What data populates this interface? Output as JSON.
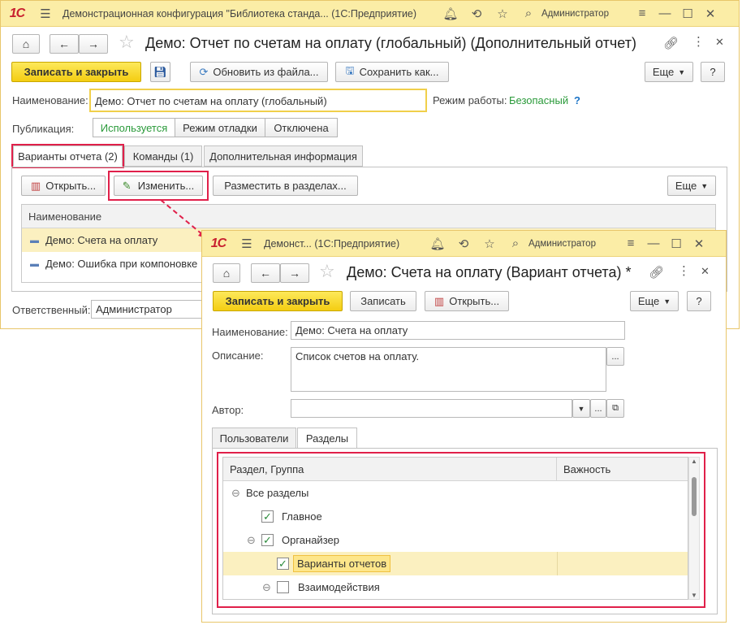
{
  "back_window": {
    "titlebar": {
      "logo": "1С",
      "title": "Демонстрационная конфигурация \"Библиотека станда...  (1С:Предприятие)",
      "user": "Администратор"
    },
    "header": "Демо: Отчет по счетам на оплату (глобальный) (Дополнительный отчет)",
    "toolbar": {
      "save_close": "Записать и закрыть",
      "update_from_file": "Обновить из файла...",
      "save_as": "Сохранить как...",
      "more": "Еще",
      "help": "?"
    },
    "name_label": "Наименование:",
    "name_value": "Демо: Отчет по счетам на оплату (глобальный)",
    "mode_label": "Режим работы:",
    "mode_value": "Безопасный",
    "mode_help": "?",
    "publication_label": "Публикация:",
    "publication_options": [
      "Используется",
      "Режим отладки",
      "Отключена"
    ],
    "tabs": [
      "Варианты отчета (2)",
      "Команды (1)",
      "Дополнительная информация"
    ],
    "variants_toolbar": {
      "open": "Открыть...",
      "edit": "Изменить...",
      "place": "Разместить в разделах...",
      "more": "Еще"
    },
    "list_header": "Наименование",
    "list_items": [
      "Демо: Счета на оплату",
      "Демо: Ошибка при компоновке"
    ],
    "responsible_label": "Ответственный:",
    "responsible_value": "Администратор"
  },
  "front_window": {
    "titlebar": {
      "logo": "1С",
      "title": "Демонст...  (1С:Предприятие)",
      "user": "Администратор"
    },
    "header": "Демо: Счета на оплату (Вариант отчета) *",
    "toolbar": {
      "save_close": "Записать и закрыть",
      "save": "Записать",
      "open": "Открыть...",
      "more": "Еще",
      "help": "?"
    },
    "name_label": "Наименование:",
    "name_value": "Демо: Счета на оплату",
    "desc_label": "Описание:",
    "desc_value": "Список счетов на оплату.",
    "author_label": "Автор:",
    "author_value": "",
    "tabs": [
      "Пользователи",
      "Разделы"
    ],
    "grid_headers": [
      "Раздел, Группа",
      "Важность"
    ],
    "tree": [
      {
        "label": "Все разделы",
        "level": 0,
        "toggle": "⊖",
        "checked": null
      },
      {
        "label": "Главное",
        "level": 1,
        "toggle": "",
        "checked": true
      },
      {
        "label": "Органайзер",
        "level": 1,
        "toggle": "⊖",
        "checked": true
      },
      {
        "label": "Варианты отчетов",
        "level": 2,
        "toggle": "",
        "checked": true
      },
      {
        "label": "Взаимодействия",
        "level": 2,
        "toggle": "⊖",
        "checked": false
      }
    ]
  }
}
